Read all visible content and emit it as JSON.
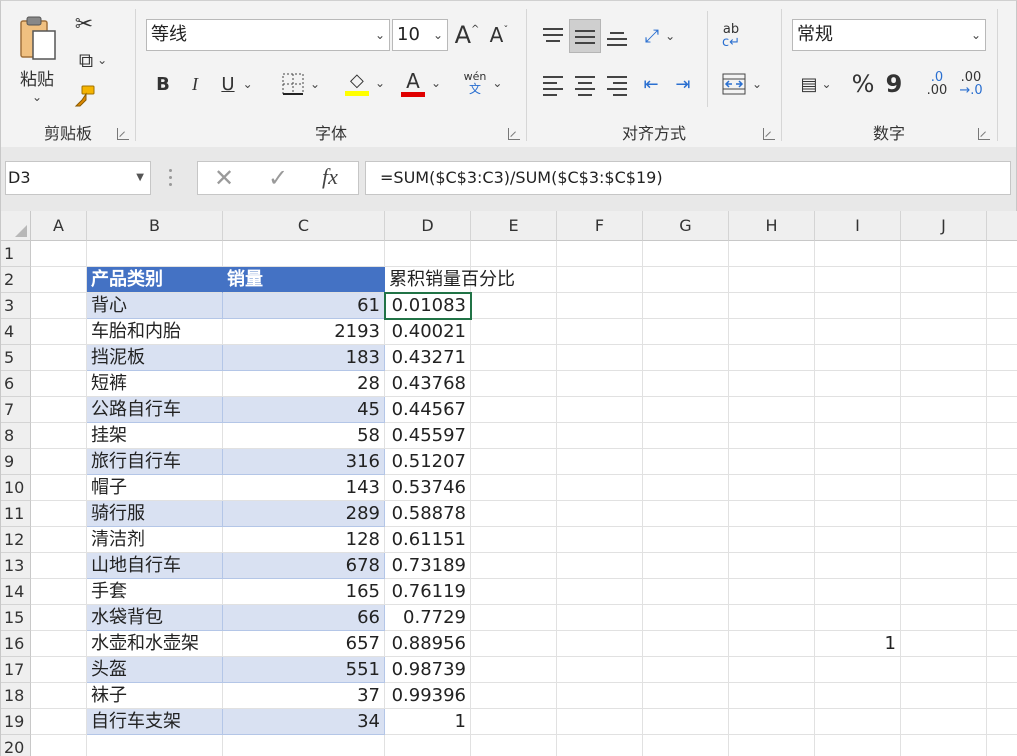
{
  "ribbon": {
    "clipboard": {
      "label": "剪贴板",
      "paste_label": "粘贴"
    },
    "font": {
      "label": "字体",
      "font_name": "等线",
      "font_size": "10",
      "grow_label": "A",
      "shrink_label": "A",
      "bold_label": "B",
      "italic_label": "I",
      "underline_label": "U",
      "phonetic_top": "wén",
      "phonetic_bottom": "文",
      "font_color_label": "A",
      "highlight_color": "#ffff00",
      "font_color": "#e00000"
    },
    "alignment": {
      "label": "对齐方式"
    },
    "number": {
      "label": "数字",
      "format": "常规",
      "percent_label": "%",
      "comma_label": "9",
      "inc_decimal_top": ".0",
      "inc_decimal_bottom": ".00",
      "dec_decimal_top": ".00",
      "dec_decimal_bottom": "→.0"
    }
  },
  "formula_bar": {
    "name_box": "D3",
    "fx_label": "fx",
    "formula": "=SUM($C$3:C3)/SUM($C$3:$C$19)"
  },
  "columns": [
    "A",
    "B",
    "C",
    "D",
    "E",
    "F",
    "G",
    "H",
    "I",
    "J"
  ],
  "rows": [
    "1",
    "2",
    "3",
    "4",
    "5",
    "6",
    "7",
    "8",
    "9",
    "10",
    "11",
    "12",
    "13",
    "14",
    "15",
    "16",
    "17",
    "18",
    "19",
    "20"
  ],
  "table": {
    "header_category": "产品类别",
    "header_sales": "销量",
    "header_cumulative": "累积销量百分比",
    "records": [
      {
        "category": "背心",
        "sales": "61",
        "pct": "0.01083"
      },
      {
        "category": "车胎和内胎",
        "sales": "2193",
        "pct": "0.40021"
      },
      {
        "category": "挡泥板",
        "sales": "183",
        "pct": "0.43271"
      },
      {
        "category": "短裤",
        "sales": "28",
        "pct": "0.43768"
      },
      {
        "category": "公路自行车",
        "sales": "45",
        "pct": "0.44567"
      },
      {
        "category": "挂架",
        "sales": "58",
        "pct": "0.45597"
      },
      {
        "category": "旅行自行车",
        "sales": "316",
        "pct": "0.51207"
      },
      {
        "category": "帽子",
        "sales": "143",
        "pct": "0.53746"
      },
      {
        "category": "骑行服",
        "sales": "289",
        "pct": "0.58878"
      },
      {
        "category": "清洁剂",
        "sales": "128",
        "pct": "0.61151"
      },
      {
        "category": "山地自行车",
        "sales": "678",
        "pct": "0.73189"
      },
      {
        "category": "手套",
        "sales": "165",
        "pct": "0.76119"
      },
      {
        "category": "水袋背包",
        "sales": "66",
        "pct": "0.7729"
      },
      {
        "category": "水壶和水壶架",
        "sales": "657",
        "pct": "0.88956"
      },
      {
        "category": "头盔",
        "sales": "551",
        "pct": "0.98739"
      },
      {
        "category": "袜子",
        "sales": "37",
        "pct": "0.99396"
      },
      {
        "category": "自行车支架",
        "sales": "34",
        "pct": "1"
      }
    ],
    "i16_value": "1"
  },
  "colors": {
    "header_fill": "#4472c4",
    "band_fill": "#d9e1f2",
    "selection": "#217346"
  }
}
